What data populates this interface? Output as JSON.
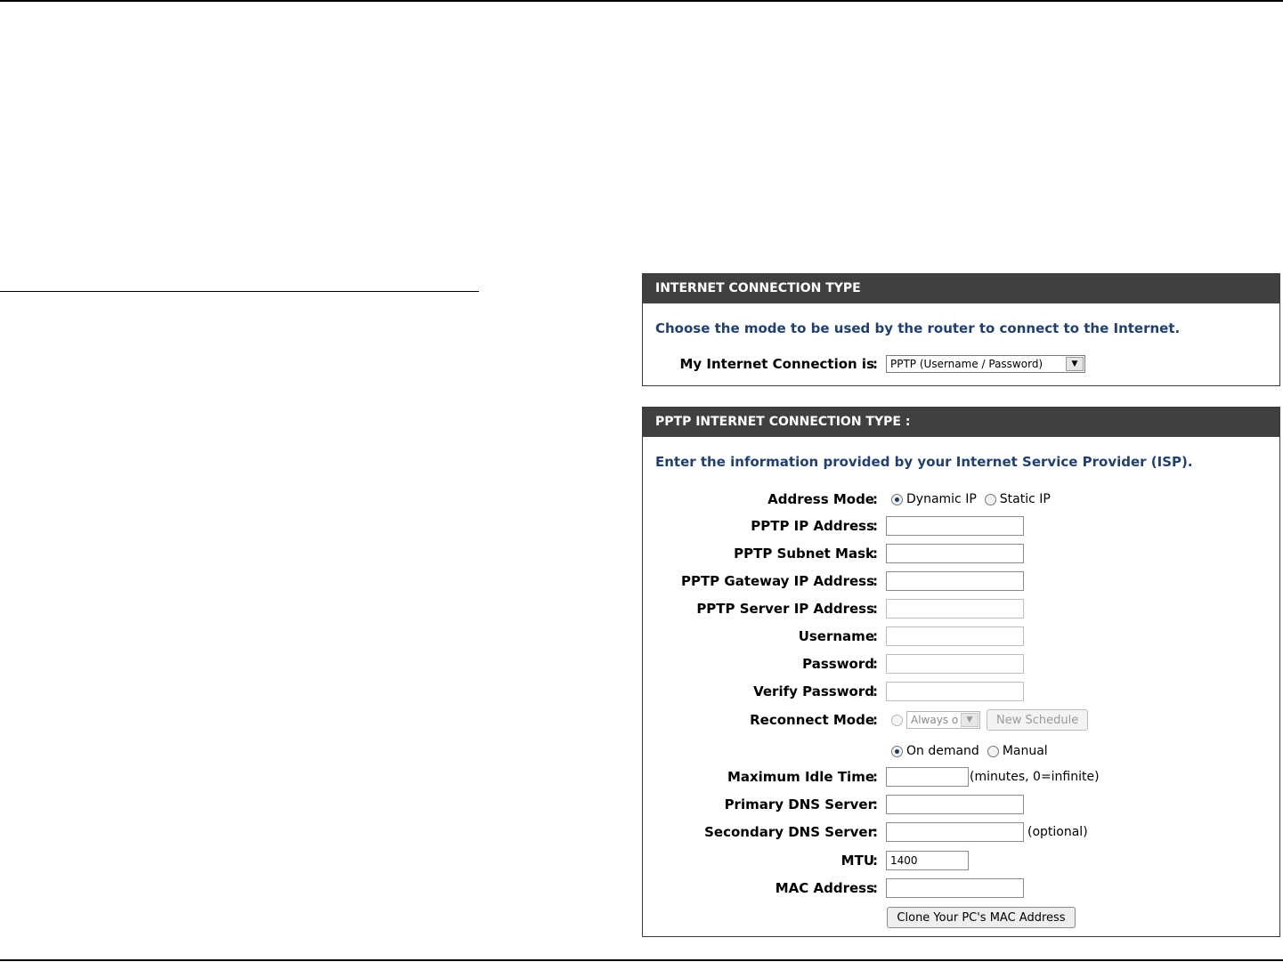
{
  "connection_type": {
    "title": "INTERNET CONNECTION TYPE",
    "intro": "Choose the mode to be used by the router to connect to the Internet.",
    "label": "My Internet Connection is",
    "selected": "PPTP (Username / Password)"
  },
  "pptp": {
    "title": "PPTP INTERNET CONNECTION TYPE :",
    "intro": "Enter the information provided by your Internet Service Provider (ISP).",
    "address_mode": {
      "label": "Address Mode",
      "option1": "Dynamic IP",
      "option2": "Static IP"
    },
    "ip_address": {
      "label": "PPTP IP Address",
      "value": ""
    },
    "subnet_mask": {
      "label": "PPTP Subnet Mask",
      "value": ""
    },
    "gateway": {
      "label": "PPTP Gateway IP Address",
      "value": ""
    },
    "server_ip": {
      "label": "PPTP Server IP Address",
      "value": ""
    },
    "username": {
      "label": "Username",
      "value": ""
    },
    "password": {
      "label": "Password",
      "value": ""
    },
    "verify_password": {
      "label": "Verify Password",
      "value": ""
    },
    "reconnect": {
      "label": "Reconnect Mode",
      "schedule_value": "Always o",
      "new_schedule": "New Schedule",
      "on_demand": "On demand",
      "manual": "Manual"
    },
    "idle_time": {
      "label": "Maximum Idle Time",
      "value": "",
      "hint": "(minutes, 0=infinite)"
    },
    "primary_dns": {
      "label": "Primary DNS Server",
      "value": ""
    },
    "secondary_dns": {
      "label": "Secondary DNS Server",
      "value": "",
      "hint": "(optional)"
    },
    "mtu": {
      "label": "MTU",
      "value": "1400"
    },
    "mac": {
      "label": "MAC Address",
      "value": "",
      "clone_button": "Clone Your PC's MAC Address"
    }
  }
}
